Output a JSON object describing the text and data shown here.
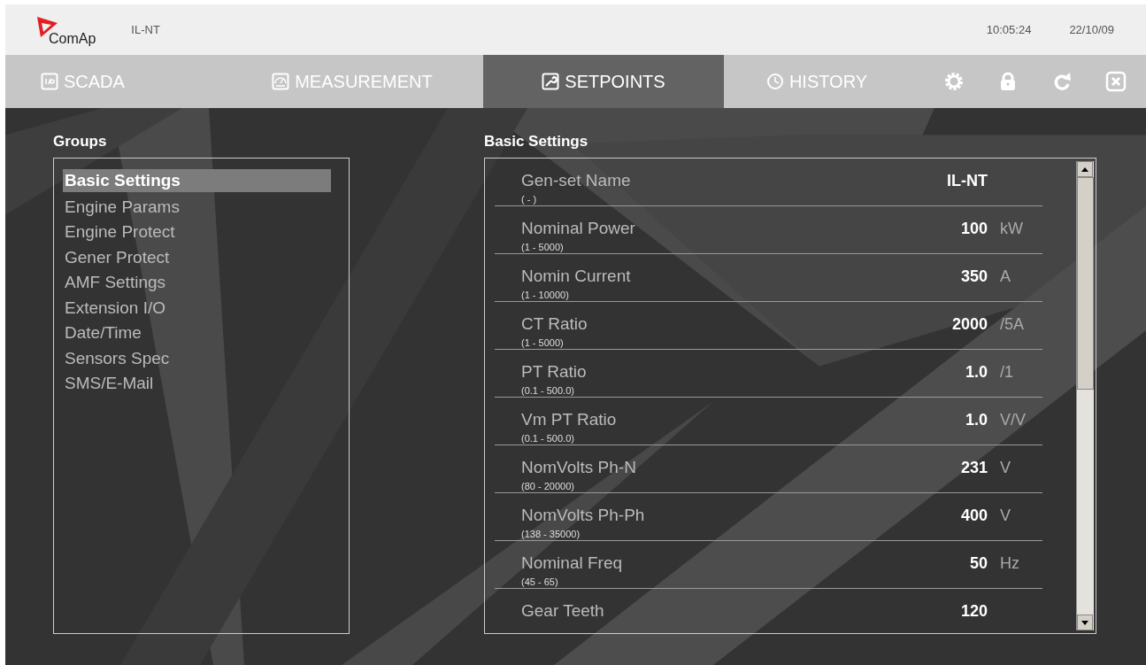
{
  "header": {
    "logo": "ComAp",
    "device": "IL-NT",
    "time": "10:05:24",
    "date": "22/10/09"
  },
  "tabs": [
    {
      "label": "SCADA",
      "kind": "io",
      "selected": false
    },
    {
      "label": "MEASUREMENT",
      "kind": "gauge",
      "selected": false
    },
    {
      "label": "SETPOINTS",
      "kind": "wrench",
      "selected": true
    },
    {
      "label": "HISTORY",
      "kind": "clock",
      "selected": false
    }
  ],
  "toolbar": [
    {
      "kind": "gear"
    },
    {
      "kind": "lock"
    },
    {
      "kind": "refresh"
    },
    {
      "kind": "close"
    }
  ],
  "groups": {
    "title": "Groups",
    "items": [
      {
        "label": "Basic Settings",
        "selected": true
      },
      {
        "label": "Engine Params",
        "selected": false
      },
      {
        "label": "Engine Protect",
        "selected": false
      },
      {
        "label": "Gener Protect",
        "selected": false
      },
      {
        "label": "AMF Settings",
        "selected": false
      },
      {
        "label": "Extension I/O",
        "selected": false
      },
      {
        "label": "Date/Time",
        "selected": false
      },
      {
        "label": "Sensors Spec",
        "selected": false
      },
      {
        "label": "SMS/E-Mail",
        "selected": false
      }
    ]
  },
  "setpoints": {
    "title": "Basic Settings",
    "rows": [
      {
        "name": "Gen-set Name",
        "range": "( - )",
        "value": "IL-NT"
      },
      {
        "name": "Nominal Power",
        "range": "(1 - 5000)",
        "value": "100",
        "unit": "kW"
      },
      {
        "name": "Nomin Current",
        "range": "(1 - 10000)",
        "value": "350",
        "unit": "A"
      },
      {
        "name": "CT Ratio",
        "range": "(1 - 5000)",
        "value": "2000",
        "unit": "/5A"
      },
      {
        "name": "PT Ratio",
        "range": "(0.1 - 500.0)",
        "value": "1.0",
        "unit": "/1"
      },
      {
        "name": "Vm PT Ratio",
        "range": "(0.1 - 500.0)",
        "value": "1.0",
        "unit": "V/V"
      },
      {
        "name": "NomVolts Ph-N",
        "range": "(80 - 20000)",
        "value": "231",
        "unit": "V"
      },
      {
        "name": "NomVolts Ph-Ph",
        "range": "(138 - 35000)",
        "value": "400",
        "unit": "V"
      },
      {
        "name": "Nominal Freq",
        "range": "(45 - 65)",
        "value": "50",
        "unit": "Hz"
      },
      {
        "name": "Gear Teeth",
        "value": "120"
      }
    ]
  }
}
